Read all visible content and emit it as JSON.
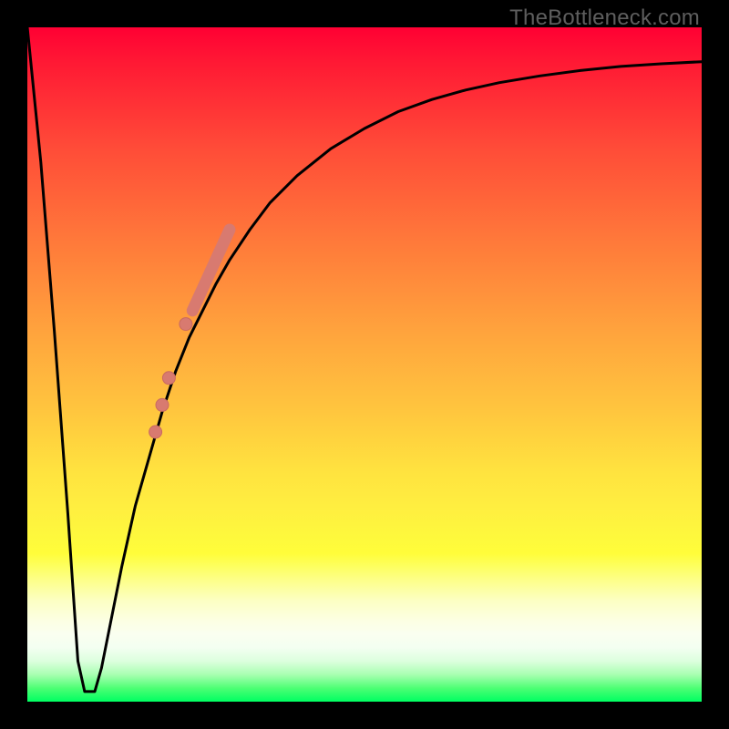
{
  "watermark_text": "TheBottleneck.com",
  "colors": {
    "frame": "#000000",
    "curve": "#000000",
    "marker_fill": "#d87a70",
    "marker_stroke": "#c96a60"
  },
  "chart_data": {
    "type": "line",
    "title": "",
    "xlabel": "",
    "ylabel": "",
    "xlim": [
      0,
      100
    ],
    "ylim": [
      0,
      100
    ],
    "grid": false,
    "gradient_description": "vertical performance gradient: red (top, high bottleneck) → orange → yellow → pale → green (bottom, no bottleneck)",
    "series": [
      {
        "name": "bottleneck-percentage-curve",
        "x": [
          0,
          2,
          4,
          6,
          7.5,
          8.5,
          10,
          11,
          12,
          14,
          16,
          18,
          20,
          22,
          24,
          26,
          28,
          30,
          33,
          36,
          40,
          45,
          50,
          55,
          60,
          65,
          70,
          76,
          82,
          88,
          94,
          100
        ],
        "y": [
          100,
          80,
          55,
          28,
          6,
          1.5,
          1.5,
          5,
          10,
          20,
          29,
          36,
          43,
          49,
          54,
          58,
          62,
          65.5,
          70,
          74,
          78,
          82,
          85,
          87.5,
          89.3,
          90.7,
          91.8,
          92.8,
          93.6,
          94.2,
          94.6,
          94.9
        ]
      },
      {
        "name": "highlighted-markers",
        "type": "scatter",
        "x": [
          19,
          20,
          21,
          23.5
        ],
        "y": [
          40,
          44,
          48,
          56
        ],
        "marker_radius": 7
      },
      {
        "name": "highlighted-segment",
        "type": "thick-line",
        "x_start": 24.5,
        "y_start": 58,
        "x_end": 30,
        "y_end": 70,
        "width": 13
      }
    ]
  }
}
